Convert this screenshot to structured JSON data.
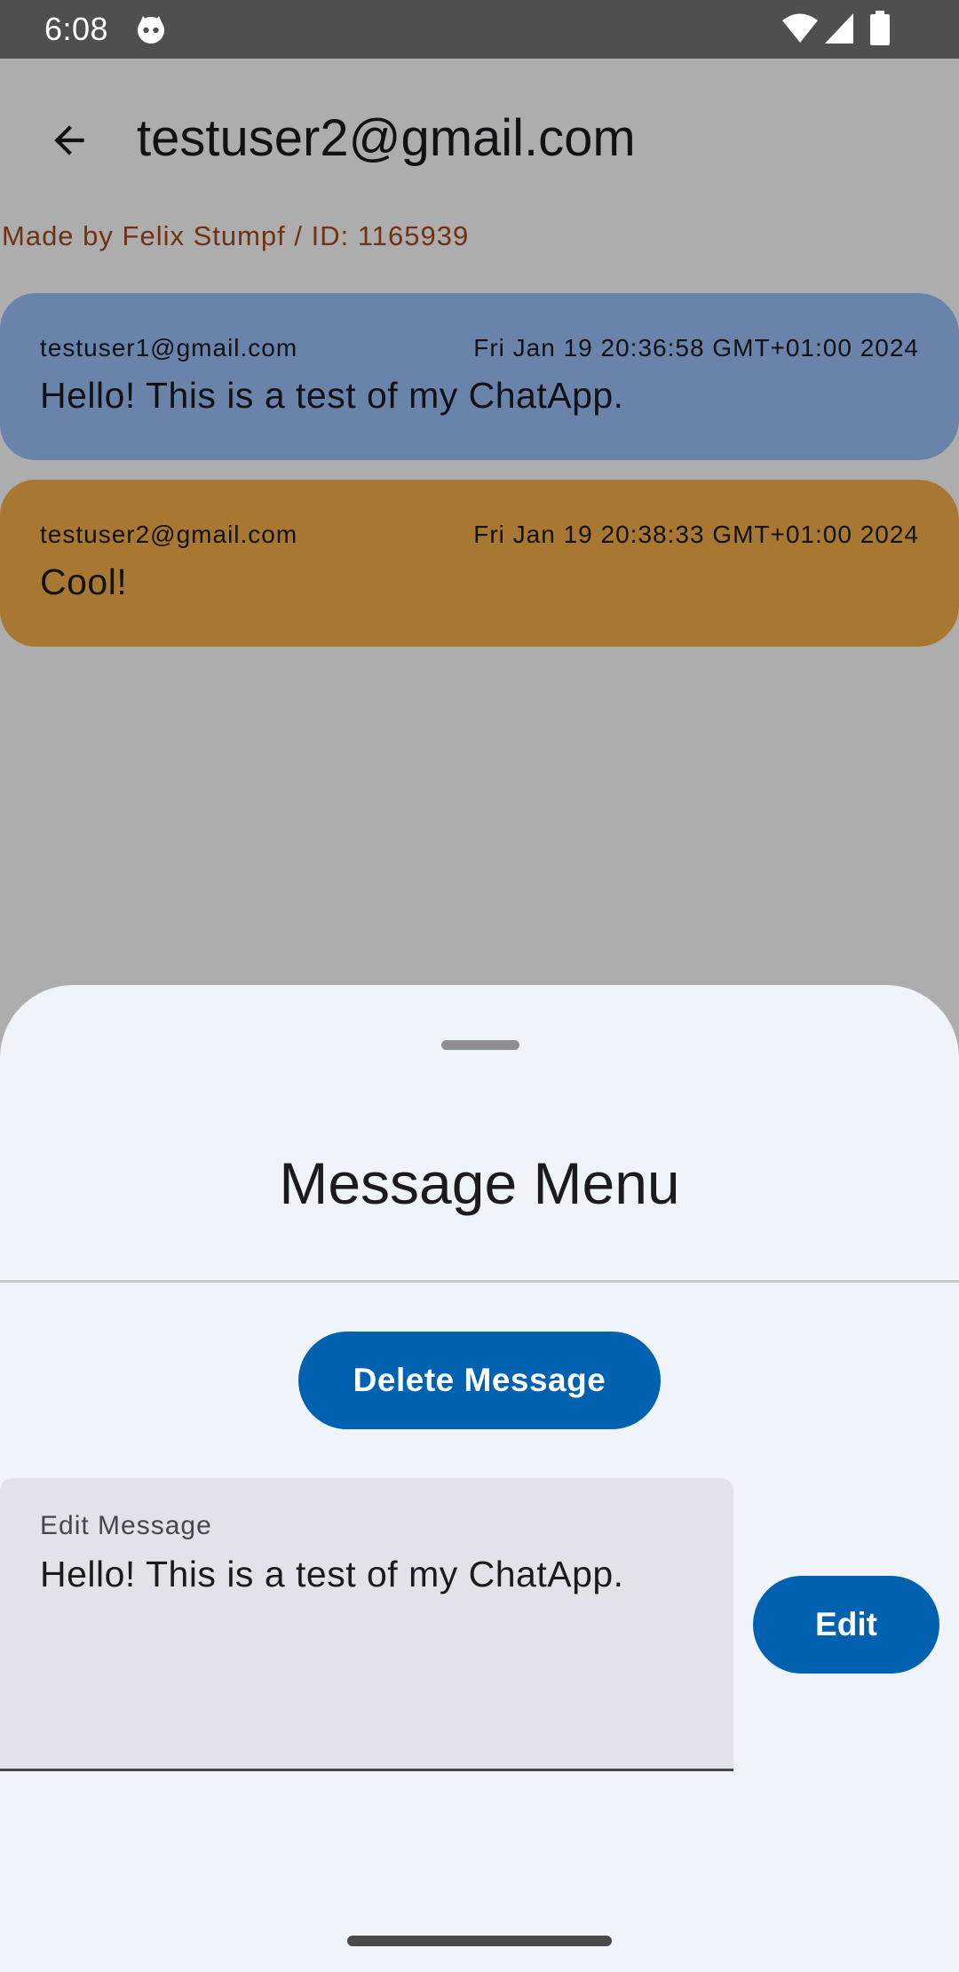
{
  "status_bar": {
    "time": "6:08",
    "icons": [
      "face-icon",
      "wifi-icon",
      "signal-icon",
      "battery-icon"
    ]
  },
  "app_bar": {
    "title": "testuser2@gmail.com",
    "back_icon": "arrow-back-icon"
  },
  "credit": "Made by Felix Stumpf / ID: 1165939",
  "messages": [
    {
      "sender": "testuser1@gmail.com",
      "timestamp": "Fri Jan 19 20:36:58 GMT+01:00 2024",
      "text": "Hello! This is a test of my ChatApp.",
      "color": "#9dc2fb"
    },
    {
      "sender": "testuser2@gmail.com",
      "timestamp": "Fri Jan 19 20:38:33 GMT+01:00 2024",
      "text": "Cool!",
      "color": "#f8b14b"
    }
  ],
  "sheet": {
    "title": "Message Menu",
    "delete_label": "Delete Message",
    "edit_field_label": "Edit Message",
    "edit_field_value": "Hello! This is a test of my ChatApp.",
    "edit_label": "Edit"
  },
  "colors": {
    "primary": "#0061b0",
    "credit": "#a44a1d",
    "sheet_background": "#eff4fb"
  }
}
